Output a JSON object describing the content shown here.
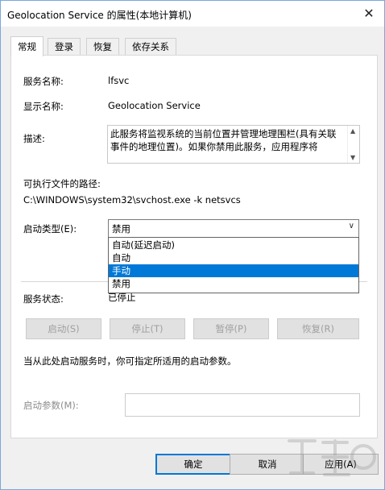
{
  "window": {
    "title": "Geolocation Service 的属性(本地计算机)"
  },
  "tabs": [
    {
      "label": "常规"
    },
    {
      "label": "登录"
    },
    {
      "label": "恢复"
    },
    {
      "label": "依存关系"
    }
  ],
  "general": {
    "service_name_label": "服务名称:",
    "service_name_value": "lfsvc",
    "display_name_label": "显示名称:",
    "display_name_value": "Geolocation Service",
    "description_label": "描述:",
    "description_value": "此服务将监视系统的当前位置并管理地理围栏(具有关联事件的地理位置)。如果你禁用此服务，应用程序将",
    "exe_path_label": "可执行文件的路径:",
    "exe_path_value": "C:\\WINDOWS\\system32\\svchost.exe -k netsvcs",
    "startup_type_label": "启动类型(E):",
    "startup_type_value": "禁用",
    "startup_options": [
      "自动(延迟启动)",
      "自动",
      "手动",
      "禁用"
    ],
    "startup_highlighted_index": 2,
    "service_status_label": "服务状态:",
    "service_status_value": "已停止",
    "buttons": {
      "start": "启动(S)",
      "stop": "停止(T)",
      "pause": "暂停(P)",
      "resume": "恢复(R)"
    },
    "hint": "当从此处启动服务时，你可指定所适用的启动参数。",
    "start_params_label": "启动参数(M):",
    "start_params_value": ""
  },
  "footer": {
    "ok": "确定",
    "cancel": "取消",
    "apply": "应用(A)"
  },
  "colors": {
    "selection": "#0078d7",
    "window_border": "#7aa7d9"
  }
}
